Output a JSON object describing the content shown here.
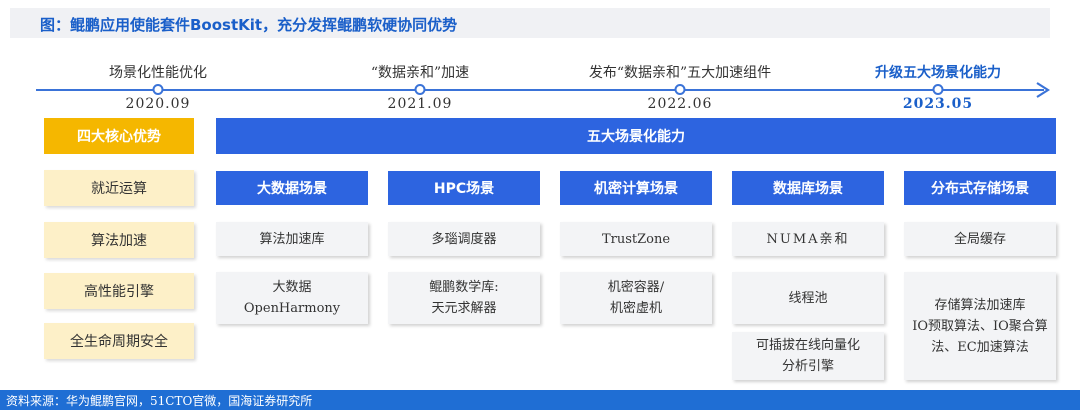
{
  "title": "图：鲲鹏应用使能套件BoostKit，充分发挥鲲鹏软硬协同优势",
  "timeline": [
    {
      "label": "场景化性能优化",
      "date": "2020.09"
    },
    {
      "label": "“数据亲和”加速",
      "date": "2021.09"
    },
    {
      "label": "发布“数据亲和”五大加速组件",
      "date": "2022.06"
    },
    {
      "label": "升级五大场景化能力",
      "date": "2023.05"
    }
  ],
  "left_header": "四大核心优势",
  "main_header": "五大场景化能力",
  "advantages": [
    "就近运算",
    "算法加速",
    "高性能引擎",
    "全生命周期安全"
  ],
  "scenarios": [
    {
      "name": "大数据场景",
      "items": [
        "算法加速库",
        "大数据\nOpenHarmony"
      ]
    },
    {
      "name": "HPC场景",
      "items": [
        "多瑙调度器",
        "鲲鹏数学库:\n天元求解器"
      ]
    },
    {
      "name": "机密计算场景",
      "items": [
        "TrustZone",
        "机密容器/\n机密虚机"
      ]
    },
    {
      "name": "数据库场景",
      "items": [
        "NUMA亲和",
        "线程池",
        "可插拔在线向量化\n分析引擎"
      ]
    },
    {
      "name": "分布式存储场景",
      "items": [
        "全局缓存",
        "存储算法加速库\nIO预取算法、IO聚合算\n法、EC加速算法"
      ]
    }
  ],
  "source": "资料来源：华为鲲鹏官网，51CTO官微，国海证券研究所",
  "colors": {
    "accent": "#2d64e0",
    "highlight_text": "#1a5fc9",
    "gold": "#f5b700",
    "cream": "#fdf0c8",
    "footer": "#1f6ed4"
  }
}
